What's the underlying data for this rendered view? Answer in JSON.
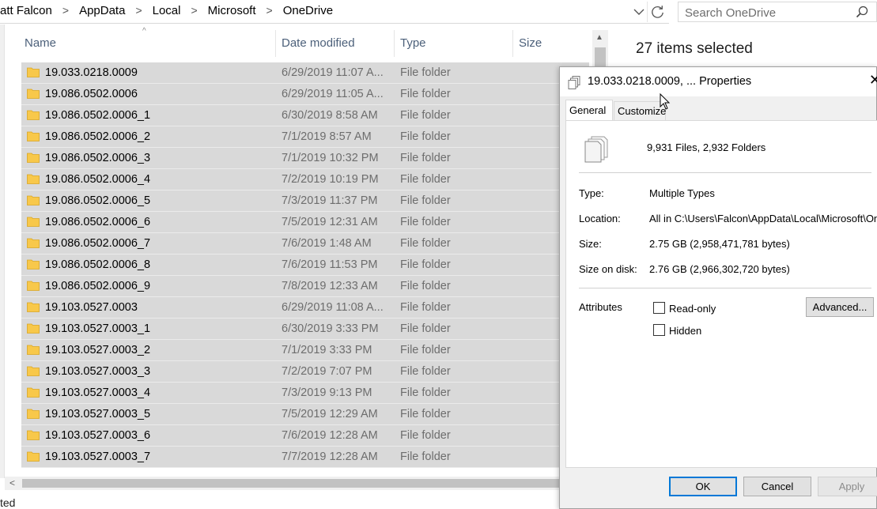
{
  "address_bar": {
    "breadcrumbs": [
      "att Falcon",
      "AppData",
      "Local",
      "Microsoft",
      "OneDrive"
    ],
    "separator": ">"
  },
  "search": {
    "placeholder": "Search OneDrive"
  },
  "columns": {
    "name": "Name",
    "date_modified": "Date modified",
    "type": "Type",
    "size": "Size"
  },
  "files": [
    {
      "name": "19.033.0218.0009",
      "date": "6/29/2019 11:07 A...",
      "type": "File folder"
    },
    {
      "name": "19.086.0502.0006",
      "date": "6/29/2019 11:05 A...",
      "type": "File folder"
    },
    {
      "name": "19.086.0502.0006_1",
      "date": "6/30/2019 8:58 AM",
      "type": "File folder"
    },
    {
      "name": "19.086.0502.0006_2",
      "date": "7/1/2019 8:57 AM",
      "type": "File folder"
    },
    {
      "name": "19.086.0502.0006_3",
      "date": "7/1/2019 10:32 PM",
      "type": "File folder"
    },
    {
      "name": "19.086.0502.0006_4",
      "date": "7/2/2019 10:19 PM",
      "type": "File folder"
    },
    {
      "name": "19.086.0502.0006_5",
      "date": "7/3/2019 11:37 PM",
      "type": "File folder"
    },
    {
      "name": "19.086.0502.0006_6",
      "date": "7/5/2019 12:31 AM",
      "type": "File folder"
    },
    {
      "name": "19.086.0502.0006_7",
      "date": "7/6/2019 1:48 AM",
      "type": "File folder"
    },
    {
      "name": "19.086.0502.0006_8",
      "date": "7/6/2019 11:53 PM",
      "type": "File folder"
    },
    {
      "name": "19.086.0502.0006_9",
      "date": "7/8/2019 12:33 AM",
      "type": "File folder"
    },
    {
      "name": "19.103.0527.0003",
      "date": "6/29/2019 11:08 A...",
      "type": "File folder"
    },
    {
      "name": "19.103.0527.0003_1",
      "date": "6/30/2019 3:33 PM",
      "type": "File folder"
    },
    {
      "name": "19.103.0527.0003_2",
      "date": "7/1/2019 3:33 PM",
      "type": "File folder"
    },
    {
      "name": "19.103.0527.0003_3",
      "date": "7/2/2019 7:07 PM",
      "type": "File folder"
    },
    {
      "name": "19.103.0527.0003_4",
      "date": "7/3/2019 9:13 PM",
      "type": "File folder"
    },
    {
      "name": "19.103.0527.0003_5",
      "date": "7/5/2019 12:29 AM",
      "type": "File folder"
    },
    {
      "name": "19.103.0527.0003_6",
      "date": "7/6/2019 12:28 AM",
      "type": "File folder"
    },
    {
      "name": "19.103.0527.0003_7",
      "date": "7/7/2019 12:28 AM",
      "type": "File folder"
    }
  ],
  "details_pane": {
    "selection": "27 items selected"
  },
  "status_bar": {
    "text": "ted"
  },
  "dialog": {
    "title": "19.033.0218.0009, ... Properties",
    "tabs": [
      "General",
      "Customize"
    ],
    "summary": "9,931 Files, 2,932 Folders",
    "properties": [
      {
        "label": "Type:",
        "value": "Multiple Types"
      },
      {
        "label": "Location:",
        "value": "All in C:\\Users\\Falcon\\AppData\\Local\\Microsoft\\OneDrive"
      },
      {
        "label": "Size:",
        "value": "2.75 GB (2,958,471,781 bytes)"
      },
      {
        "label": "Size on disk:",
        "value": "2.76 GB (2,966,302,720 bytes)"
      }
    ],
    "attributes_label": "Attributes",
    "read_only": "Read-only",
    "hidden": "Hidden",
    "advanced": "Advanced...",
    "ok": "OK",
    "cancel": "Cancel",
    "apply": "Apply"
  },
  "colors": {
    "selection": "#d9d9d9",
    "header_text": "#4c607a",
    "folder_yellow": "#f8c84a",
    "accent": "#0078d7"
  }
}
